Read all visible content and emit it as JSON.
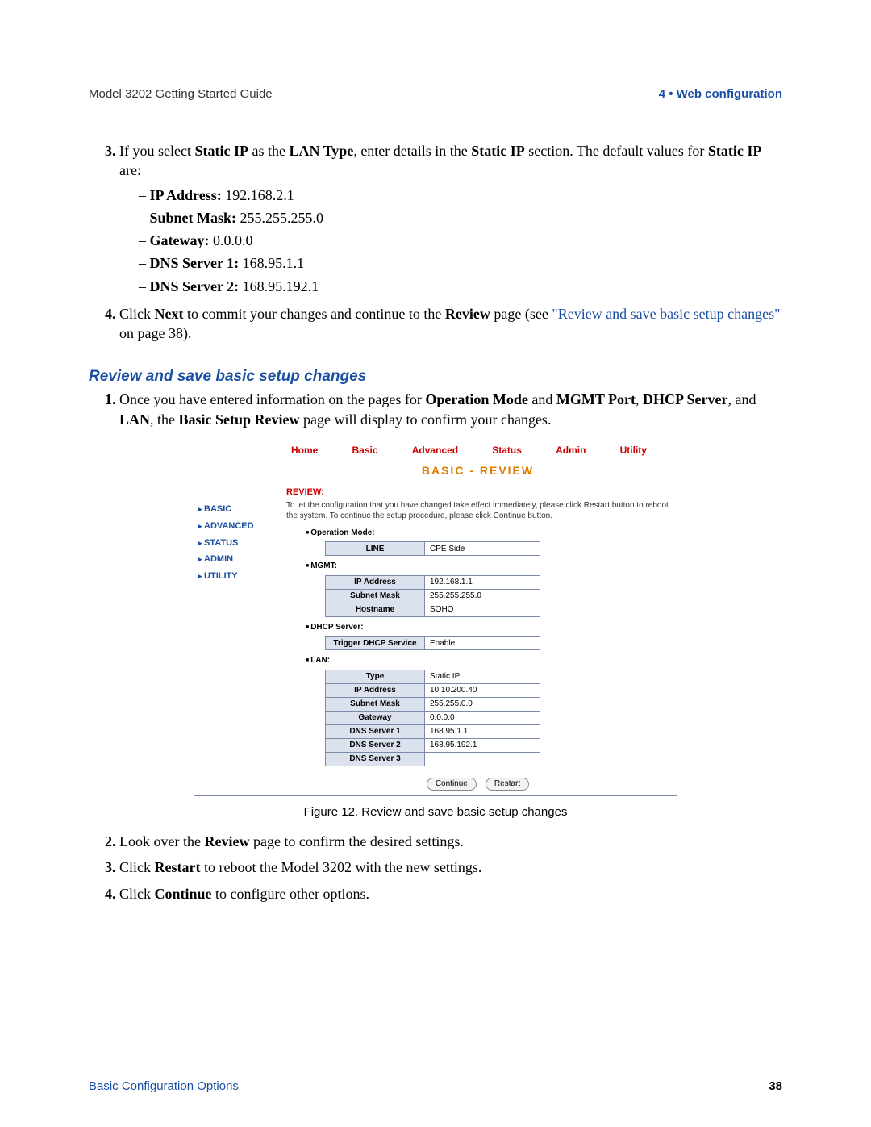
{
  "header": {
    "left": "Model 3202 Getting Started Guide",
    "right": "4 • Web configuration"
  },
  "step3": {
    "pre": "If you select ",
    "b1": "Static IP",
    "mid1": " as the ",
    "b2": "LAN Type",
    "mid2": ", enter details in the ",
    "b3": "Static IP",
    "mid3": " section. The default values for ",
    "b4": "Static IP",
    "post": " are:"
  },
  "defaults": [
    {
      "label": "IP Address:",
      "value": " 192.168.2.1"
    },
    {
      "label": "Subnet Mask:",
      "value": " 255.255.255.0"
    },
    {
      "label": "Gateway:",
      "value": " 0.0.0.0"
    },
    {
      "label": "DNS Server 1:",
      "value": " 168.95.1.1"
    },
    {
      "label": "DNS Server 2:",
      "value": " 168.95.192.1"
    }
  ],
  "step4": {
    "pre": "Click ",
    "b1": "Next",
    "mid1": " to commit your changes and continue to the ",
    "b2": "Review",
    "mid2": " page (see ",
    "link": "\"Review and save basic setup changes\"",
    "post": " on page 38)."
  },
  "heading": "Review and save basic setup changes",
  "step1b": {
    "pre": "Once you have entered information on the pages for ",
    "b1": "Operation Mode",
    "mid1": " and ",
    "b2": "MGMT Port",
    "sep": ", ",
    "b3": "DHCP Server",
    "mid2": ", and ",
    "b4": "LAN",
    "mid3": ", the ",
    "b5": "Basic Setup Review",
    "post": " page will display to confirm your changes."
  },
  "ui": {
    "tabs": [
      "Home",
      "Basic",
      "Advanced",
      "Status",
      "Admin",
      "Utility"
    ],
    "side": [
      "BASIC",
      "ADVANCED",
      "STATUS",
      "ADMIN",
      "UTILITY"
    ],
    "title": "BASIC - REVIEW",
    "review_label": "REVIEW:",
    "review_help": "To let the configuration that you have changed take effect immediately, please click Restart button to reboot the system. To continue the setup procedure, please click Continue button.",
    "sections": {
      "op": {
        "title": "Operation Mode:",
        "rows": [
          [
            "LINE",
            "CPE Side"
          ]
        ]
      },
      "mgmt": {
        "title": "MGMT:",
        "rows": [
          [
            "IP Address",
            "192.168.1.1"
          ],
          [
            "Subnet Mask",
            "255.255.255.0"
          ],
          [
            "Hostname",
            "SOHO"
          ]
        ]
      },
      "dhcp": {
        "title": "DHCP Server:",
        "rows": [
          [
            "Trigger DHCP Service",
            "Enable"
          ]
        ]
      },
      "lan": {
        "title": "LAN:",
        "rows": [
          [
            "Type",
            "Static IP"
          ],
          [
            "IP Address",
            "10.10.200.40"
          ],
          [
            "Subnet Mask",
            "255.255.0.0"
          ],
          [
            "Gateway",
            "0.0.0.0"
          ],
          [
            "DNS Server 1",
            "168.95.1.1"
          ],
          [
            "DNS Server 2",
            "168.95.192.1"
          ],
          [
            "DNS Server 3",
            ""
          ]
        ]
      }
    },
    "buttons": {
      "continue": "Continue",
      "restart": "Restart"
    }
  },
  "fig_caption": "Figure 12. Review and save basic setup changes",
  "step2b": {
    "pre": "Look over the ",
    "b1": "Review",
    "post": " page to confirm the desired settings."
  },
  "step3b": {
    "pre": "Click ",
    "b1": "Restart",
    "post": " to reboot the Model 3202 with the new settings."
  },
  "step4b": {
    "pre": "Click ",
    "b1": "Continue",
    "post": " to configure other options."
  },
  "footer": {
    "left": "Basic Configuration Options",
    "right": "38"
  }
}
